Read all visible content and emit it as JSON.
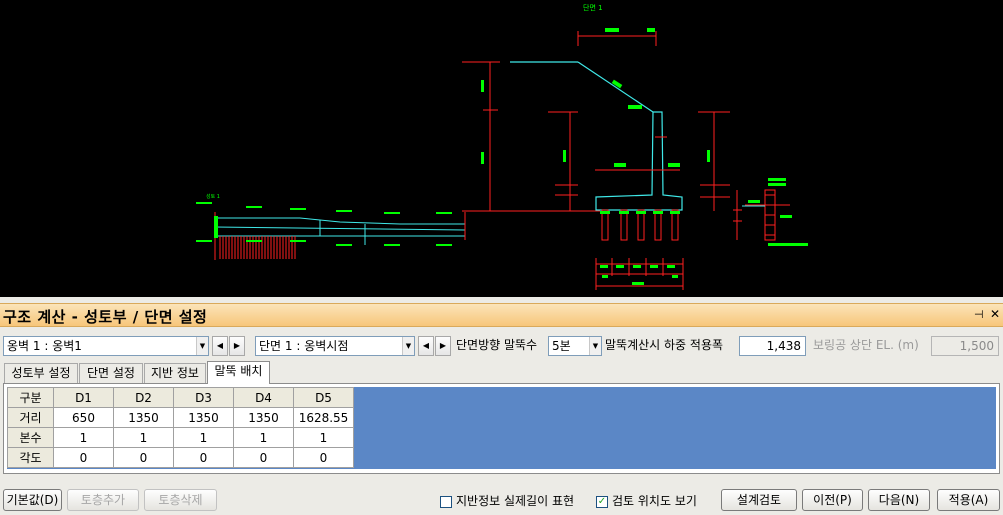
{
  "colors": {
    "cad_background": "#000000",
    "cad_green": "#00ff00",
    "cad_cyan": "#3fe8e8",
    "cad_red": "#ff2020",
    "title_gradient_top": "#fbe4b9",
    "title_gradient_bottom": "#f7c67a",
    "grid_background": "#5b87c6"
  },
  "drawing": {
    "section_title": "단면 1",
    "small_section_title": "성토 1"
  },
  "panel": {
    "title": "구조 계산 - 성토부 / 단면 설정",
    "pin_icon": "⊣",
    "close_icon": "✕"
  },
  "controls": {
    "wall_select": "옹벽 1 : 옹벽1",
    "section_select": "단면   1 : 옹벽시점",
    "pile_count_label": "단면방향 말뚝수",
    "pile_count_select": "5본",
    "load_width_label": "말뚝계산시 하중 적용폭",
    "load_width_value": "1,438",
    "boring_label": "보링공 상단 EL. (m)",
    "boring_value": "1,500"
  },
  "tabs": [
    {
      "label": "성토부 설정",
      "active": false
    },
    {
      "label": "단면 설정",
      "active": false
    },
    {
      "label": "지반 정보",
      "active": false
    },
    {
      "label": "말뚝 배치",
      "active": true
    }
  ],
  "grid": {
    "header": [
      "구분",
      "D1",
      "D2",
      "D3",
      "D4",
      "D5"
    ],
    "rows": [
      [
        "거리",
        "650",
        "1350",
        "1350",
        "1350",
        "1628.55"
      ],
      [
        "본수",
        "1",
        "1",
        "1",
        "1",
        "1"
      ],
      [
        "각도",
        "0",
        "0",
        "0",
        "0",
        "0"
      ]
    ]
  },
  "bottom": {
    "default_button": "기본값(D)",
    "add_layer_button": "토층추가",
    "delete_layer_button": "토층삭제",
    "actual_length_label": "지반정보 실제길이 표현",
    "actual_length_checked": false,
    "show_location_label": "검토 위치도 보기",
    "show_location_checked": true,
    "check_mark": "✓",
    "design_review_button": "설계검토",
    "prev_button": "이전(P)",
    "next_button": "다음(N)",
    "apply_button": "적용(A)"
  }
}
